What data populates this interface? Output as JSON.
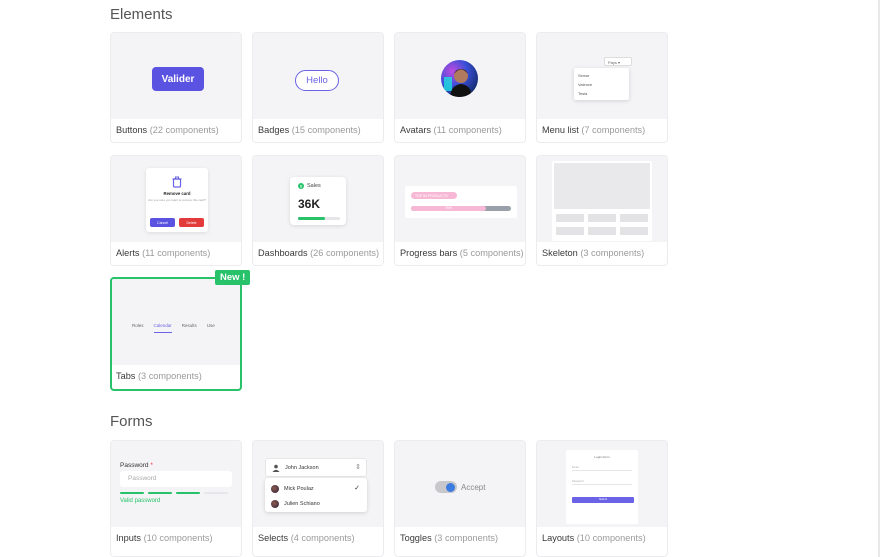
{
  "sections": {
    "elements_title": "Elements",
    "forms_title": "Forms"
  },
  "cards": {
    "buttons": {
      "name": "Buttons",
      "count": "(22 components)",
      "preview_label": "Valider"
    },
    "badges": {
      "name": "Badges",
      "count": "(15 components)",
      "preview_label": "Hello"
    },
    "avatars": {
      "name": "Avatars",
      "count": "(11 components)"
    },
    "menu_list": {
      "name": "Menu list",
      "count": "(7 components)",
      "button_label": "Pays ▾",
      "items": [
        "Sense",
        "Valence",
        "Tesla"
      ]
    },
    "alerts": {
      "name": "Alerts",
      "count": "(11 components)",
      "title": "Remove card",
      "text": "Are you sure you want to remove this card?",
      "cancel": "Cancel",
      "delete": "Delete"
    },
    "dashboards": {
      "name": "Dashboards",
      "count": "(26 components)",
      "label": "Sales",
      "value": "36K",
      "progress": 0.65
    },
    "progress_bars": {
      "name": "Progress bars",
      "count": "(5 components)",
      "pill_label": "TOP 50 PRODUCTS",
      "fill_label": "75%",
      "progress": 0.75
    },
    "skeleton": {
      "name": "Skeleton",
      "count": "(3 components)"
    },
    "tabs": {
      "name": "Tabs",
      "count": "(3 components)",
      "badge": "New !",
      "tab_items": [
        "Roles",
        "Calendar",
        "Results",
        "Use"
      ],
      "active": "Calendar"
    },
    "inputs": {
      "name": "Inputs",
      "count": "(10 components)",
      "label": "Password",
      "required": "*",
      "placeholder": "Password",
      "valid_text": "Valid password"
    },
    "selects": {
      "name": "Selects",
      "count": "(4 components)",
      "selected": "John Jackson",
      "options": [
        "Mick Poulaz",
        "Julien Schiano"
      ],
      "checked": "✓",
      "chevron": "⇕"
    },
    "toggles": {
      "name": "Toggles",
      "count": "(3 components)",
      "label": "Accept",
      "on": true
    },
    "layouts": {
      "name": "Layouts",
      "count": "(10 components)",
      "title": "Login Form",
      "fields": [
        "Email",
        "Password"
      ],
      "button": "Submit"
    }
  },
  "colors": {
    "accent": "#5a52e0",
    "success": "#27c26a",
    "danger": "#e33b3b",
    "pink": "#f7b8d6"
  }
}
